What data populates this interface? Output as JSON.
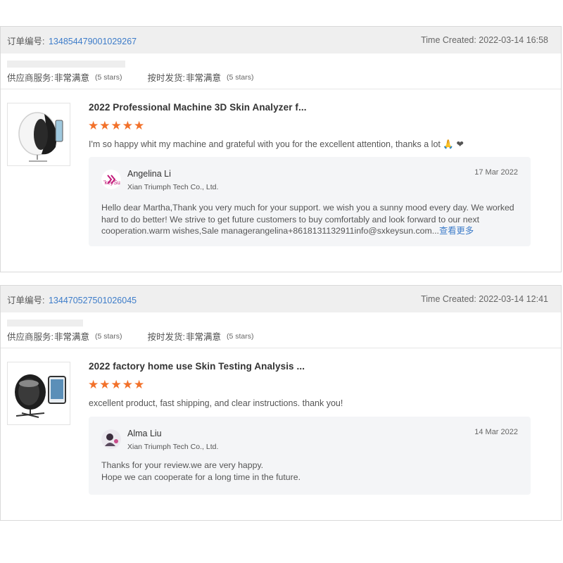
{
  "orders": [
    {
      "order_label": "订单编号:",
      "order_number": "1348544790010292​67",
      "time_created": "Time Created: 2022-03-14 16:58",
      "ratings": [
        {
          "label": "供应商服务:",
          "value": "非常满意",
          "stars": "(5 stars)"
        },
        {
          "label": "按时发货:",
          "value": "非常满意",
          "stars": "(5 stars)"
        }
      ],
      "product_title": "2022 Professional Machine 3D Skin Analyzer f...",
      "star_rating": "★★★★★",
      "review_text": "I'm so happy  whit my machine and grateful with you for the excellent attention, thanks a lot 🙏 ❤",
      "reply": {
        "name": "Angelina Li",
        "company": "Xian Triumph Tech Co., Ltd.",
        "date": "17 Mar 2022",
        "avatar_text": "'keySu",
        "lines": [
          "Hello dear Martha,Thank you very much for your support. we wish you a sunny mood every day. We worked",
          "hard to do better! We strive to get future customers to buy comfortably and look forward to our next",
          "cooperation.warm wishes,Sale managerangelina+8618131132911info@sxkeysun.com..."
        ],
        "more_label": "查看更多"
      }
    },
    {
      "order_label": "订单编号:",
      "order_number": "134470527501026045",
      "time_created": "Time Created: 2022-03-14 12:41",
      "ratings": [
        {
          "label": "供应商服务:",
          "value": "非常满意",
          "stars": "(5 stars)"
        },
        {
          "label": "按时发货:",
          "value": "非常满意",
          "stars": "(5 stars)"
        }
      ],
      "product_title": "2022 factory home use Skin Testing Analysis ...",
      "star_rating": "★★★★★",
      "review_text": "excellent product, fast shipping, and clear instructions. thank you!",
      "reply": {
        "name": "Alma Liu",
        "company": "Xian Triumph Tech Co., Ltd.",
        "date": "14 Mar 2022",
        "lines": [
          "Thanks for your review.we are very happy.",
          "Hope we can cooperate for a long time in the future."
        ]
      }
    }
  ],
  "colors": {
    "link": "#3d7cc9",
    "star": "#f2712a",
    "header_bg": "#efefef",
    "reply_bg": "#f4f5f7"
  }
}
